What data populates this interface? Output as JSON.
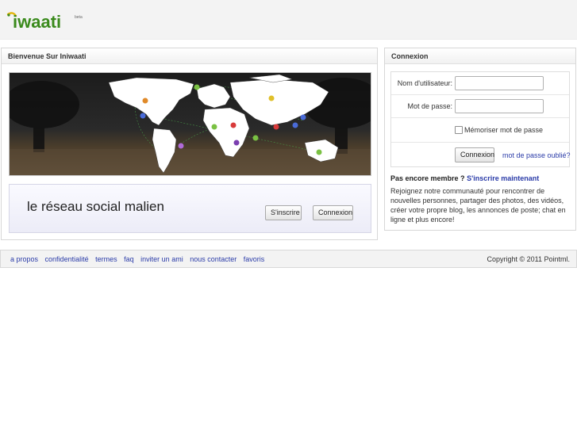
{
  "header": {
    "logo": {
      "text": "iwaati",
      "suffix": "beta"
    }
  },
  "welcome": {
    "title": "Bienvenue Sur Iniwaati",
    "tagline": "le réseau social malien",
    "signup_button": "S'inscrire",
    "login_button": "Connexion"
  },
  "login": {
    "title": "Connexion",
    "username_label": "Nom d'utilisateur:",
    "username_value": "",
    "password_label": "Mot de passe:",
    "password_value": "",
    "remember_label": "Mémoriser mot de passe",
    "remember_checked": false,
    "submit_button": "Connexion",
    "forgot_link": "mot de passe oublié?",
    "cta_question": "Pas encore membre ?",
    "cta_link": "S'inscrire maintenant",
    "cta_description": "Rejoignez notre communauté pour rencontrer de nouvelles personnes, partager des photos, des vidéos, créer votre propre blog, les annonces de poste; chat en ligne et plus encore!"
  },
  "footer": {
    "links": [
      "a propos",
      "confidentialité",
      "termes",
      "faq",
      "inviter un ami",
      "nous contacter",
      "favoris"
    ],
    "copyright": "Copyright © 2011 Pointml."
  },
  "colors": {
    "link": "#2a3ba8",
    "logo_green": "#3a8a1c",
    "logo_yellow": "#e2b40a",
    "header_bg": "#f3f3f3"
  },
  "icons": {
    "map_markers": "user-pin-icon"
  }
}
